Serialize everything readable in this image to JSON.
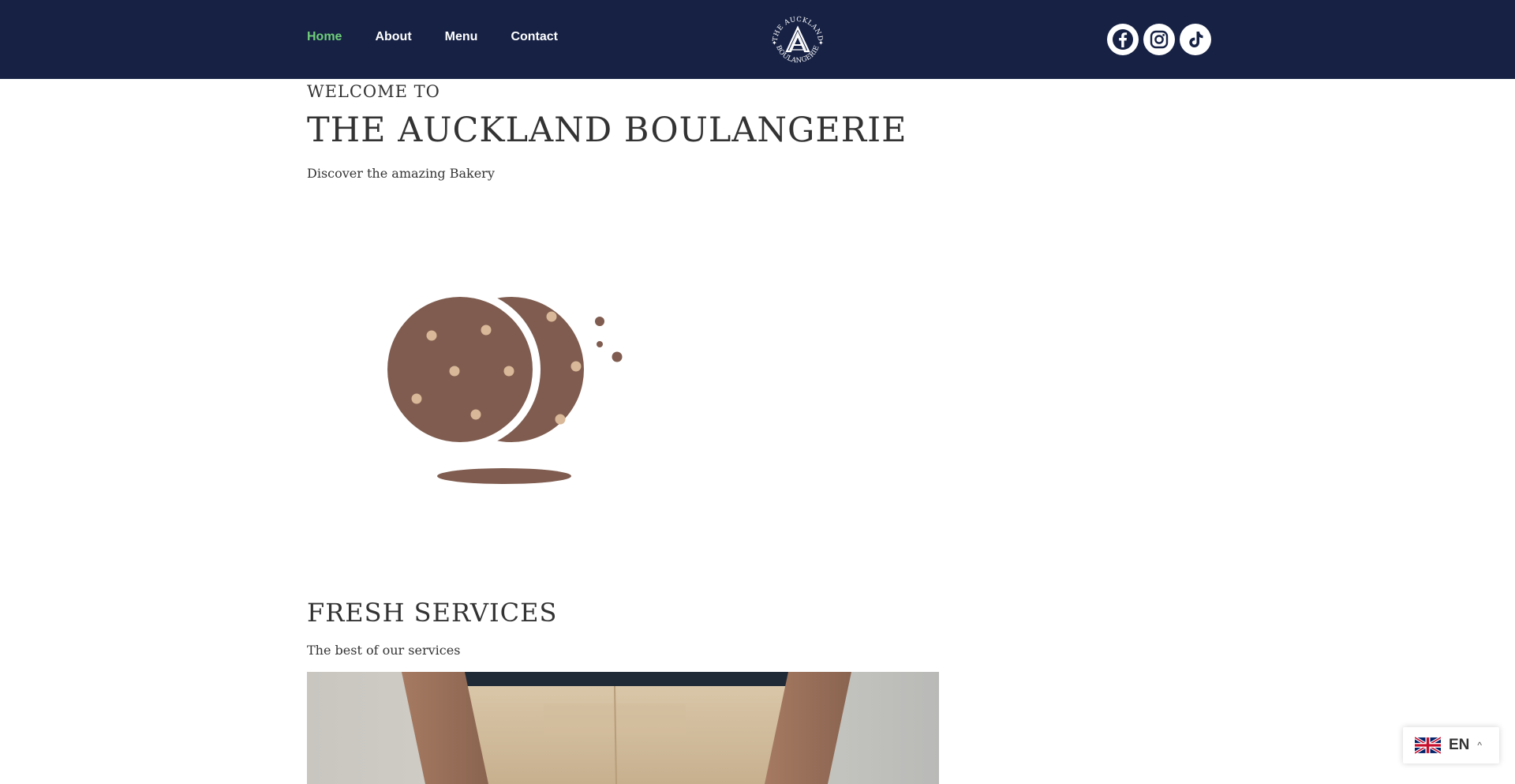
{
  "nav": {
    "items": [
      {
        "label": "Home",
        "active": true
      },
      {
        "label": "About"
      },
      {
        "label": "Menu"
      },
      {
        "label": "Contact"
      }
    ]
  },
  "logo": {
    "top_text": "THE AUCKLAND",
    "bottom_text": "BOULANGERIE"
  },
  "social": [
    {
      "icon": "facebook-icon"
    },
    {
      "icon": "instagram-icon"
    },
    {
      "icon": "tiktok-icon"
    }
  ],
  "hero": {
    "welcome": "WELCOME TO",
    "title": "THE AUCKLAND BOULANGERIE",
    "subtitle": "Discover the amazing Bakery"
  },
  "services": {
    "title": "FRESH SERVICES",
    "subtitle": "The best of our services"
  },
  "language": {
    "code": "EN",
    "flag": "uk-flag-icon"
  },
  "colors": {
    "header_bg": "#162144",
    "nav_active": "#6fce79",
    "cookie": "#7f5c4f",
    "chip": "#d8b898"
  }
}
